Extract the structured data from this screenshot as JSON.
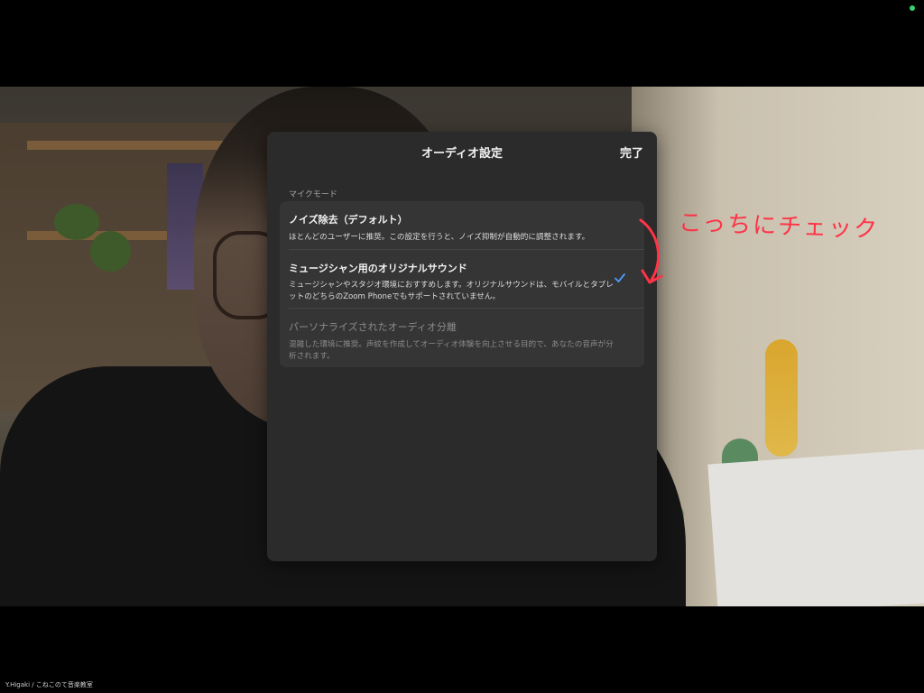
{
  "dialog": {
    "title": "オーディオ設定",
    "done_label": "完了",
    "section_label": "マイクモード",
    "options": [
      {
        "title": "ノイズ除去（デフォルト）",
        "description": "ほとんどのユーザーに推奨。この設定を行うと、ノイズ抑制が自動的に調整されます。",
        "selected": false,
        "enabled": true
      },
      {
        "title": "ミュージシャン用のオリジナルサウンド",
        "description": "ミュージシャンやスタジオ環境におすすめします。オリジナルサウンドは、モバイルとタブレットのどちらのZoom Phoneでもサポートされていません。",
        "selected": true,
        "enabled": true
      },
      {
        "title": "パーソナライズされたオーディオ分離",
        "description": "混雑した環境に推奨。声紋を作成してオーディオ体験を向上させる目的で、あなたの音声が分析されます。",
        "selected": false,
        "enabled": false
      }
    ]
  },
  "annotation": {
    "text": "こっちにチェック",
    "color": "#ff3347"
  },
  "caption": "Y.Higaki / こねこのて音楽教室",
  "icons": {
    "selected_marker": "checkmark-icon",
    "annotation_pointer": "arrow-icon"
  },
  "colors": {
    "dialog_bg": "#2b2b2b",
    "group_bg": "#353535",
    "accent_check": "#4a9eff",
    "status_dot": "#36d46b"
  }
}
